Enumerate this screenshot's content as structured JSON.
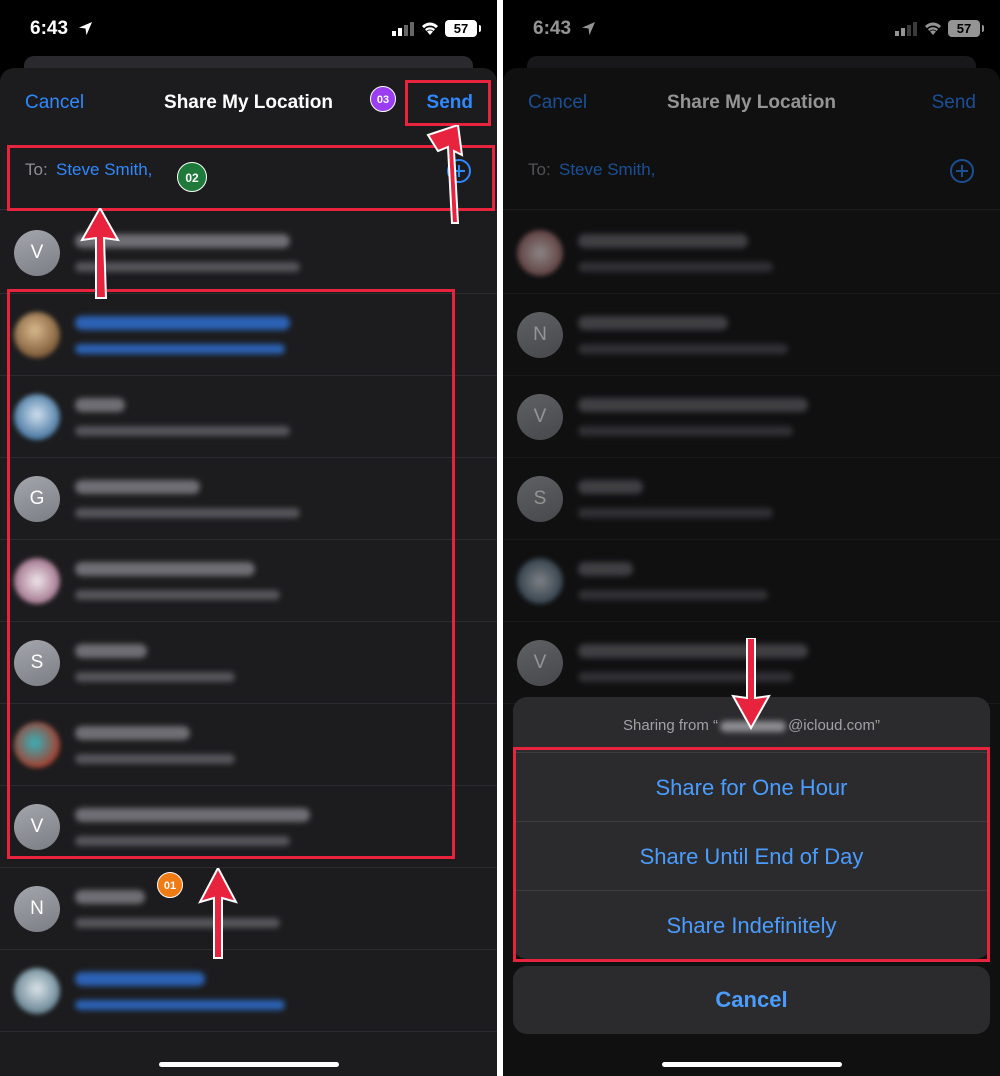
{
  "status_bar": {
    "time": "6:43",
    "battery": "57"
  },
  "share_sheet": {
    "cancel_label": "Cancel",
    "title": "Share My Location",
    "send_label": "Send",
    "to_label": "To:",
    "recipient": "Steve Smith,"
  },
  "left_contacts": [
    {
      "initial": "V"
    },
    {
      "initial": ""
    },
    {
      "initial": ""
    },
    {
      "initial": "G"
    },
    {
      "initial": ""
    },
    {
      "initial": "S"
    },
    {
      "initial": ""
    },
    {
      "initial": "V"
    },
    {
      "initial": "N"
    },
    {
      "initial": ""
    }
  ],
  "right_contacts": [
    {
      "initial": ""
    },
    {
      "initial": "N"
    },
    {
      "initial": "V"
    },
    {
      "initial": "S"
    },
    {
      "initial": ""
    },
    {
      "initial": "V"
    }
  ],
  "action_sheet": {
    "caption_prefix": "Sharing from “",
    "caption_suffix": "@icloud.com”",
    "options": [
      "Share for One Hour",
      "Share Until End of Day",
      "Share Indefinitely"
    ],
    "cancel_label": "Cancel"
  },
  "annotations": {
    "step1": "01",
    "step2": "02",
    "step3": "03"
  },
  "colors": {
    "ios_blue": "#2f89ff",
    "highlight_red": "#e8233e",
    "badge_orange": "#f07a14",
    "badge_green": "#1e7a3a",
    "badge_purple": "#9b3df0"
  }
}
